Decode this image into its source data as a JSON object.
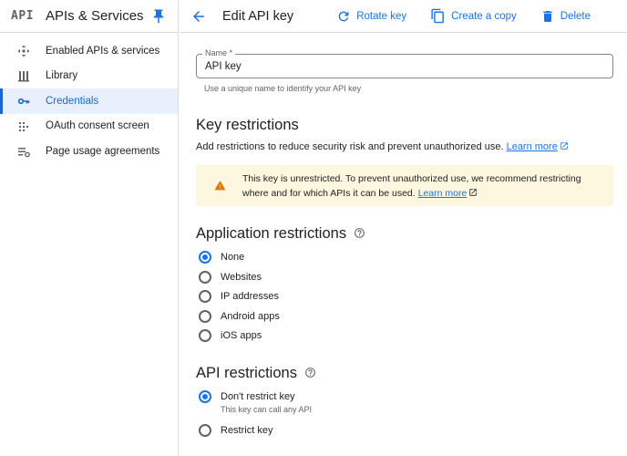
{
  "sidebar": {
    "logo": "API",
    "title": "APIs & Services",
    "items": [
      {
        "label": "Enabled APIs & services",
        "icon": "enabled-apis-icon"
      },
      {
        "label": "Library",
        "icon": "library-icon"
      },
      {
        "label": "Credentials",
        "icon": "key-icon"
      },
      {
        "label": "OAuth consent screen",
        "icon": "consent-icon"
      },
      {
        "label": "Page usage agreements",
        "icon": "settings-list-icon"
      }
    ],
    "active_index": 2
  },
  "header": {
    "title": "Edit API key",
    "rotate_label": "Rotate key",
    "copy_label": "Create a copy",
    "delete_label": "Delete"
  },
  "name_field": {
    "label": "Name *",
    "value": "API key",
    "hint": "Use a unique name to identify your API key"
  },
  "key_restrictions": {
    "title": "Key restrictions",
    "description": "Add restrictions to reduce security risk and prevent unauthorized use.",
    "learn_more": "Learn more"
  },
  "warning": {
    "text": "This key is unrestricted. To prevent unauthorized use, we recommend restricting where and for which APIs it can be used.",
    "learn_more": "Learn more"
  },
  "application_restrictions": {
    "title": "Application restrictions",
    "options": [
      "None",
      "Websites",
      "IP addresses",
      "Android apps",
      "iOS apps"
    ],
    "selected": "None"
  },
  "api_restrictions": {
    "title": "API restrictions",
    "options": [
      "Don't restrict key",
      "Restrict key"
    ],
    "selected": "Don't restrict key",
    "dont_restrict_hint": "This key can call any API"
  },
  "colors": {
    "accent": "#1a73e8",
    "active_bg": "#e8f0fe",
    "warning_bg": "#fef7e0",
    "warning_icon": "#e37400"
  }
}
